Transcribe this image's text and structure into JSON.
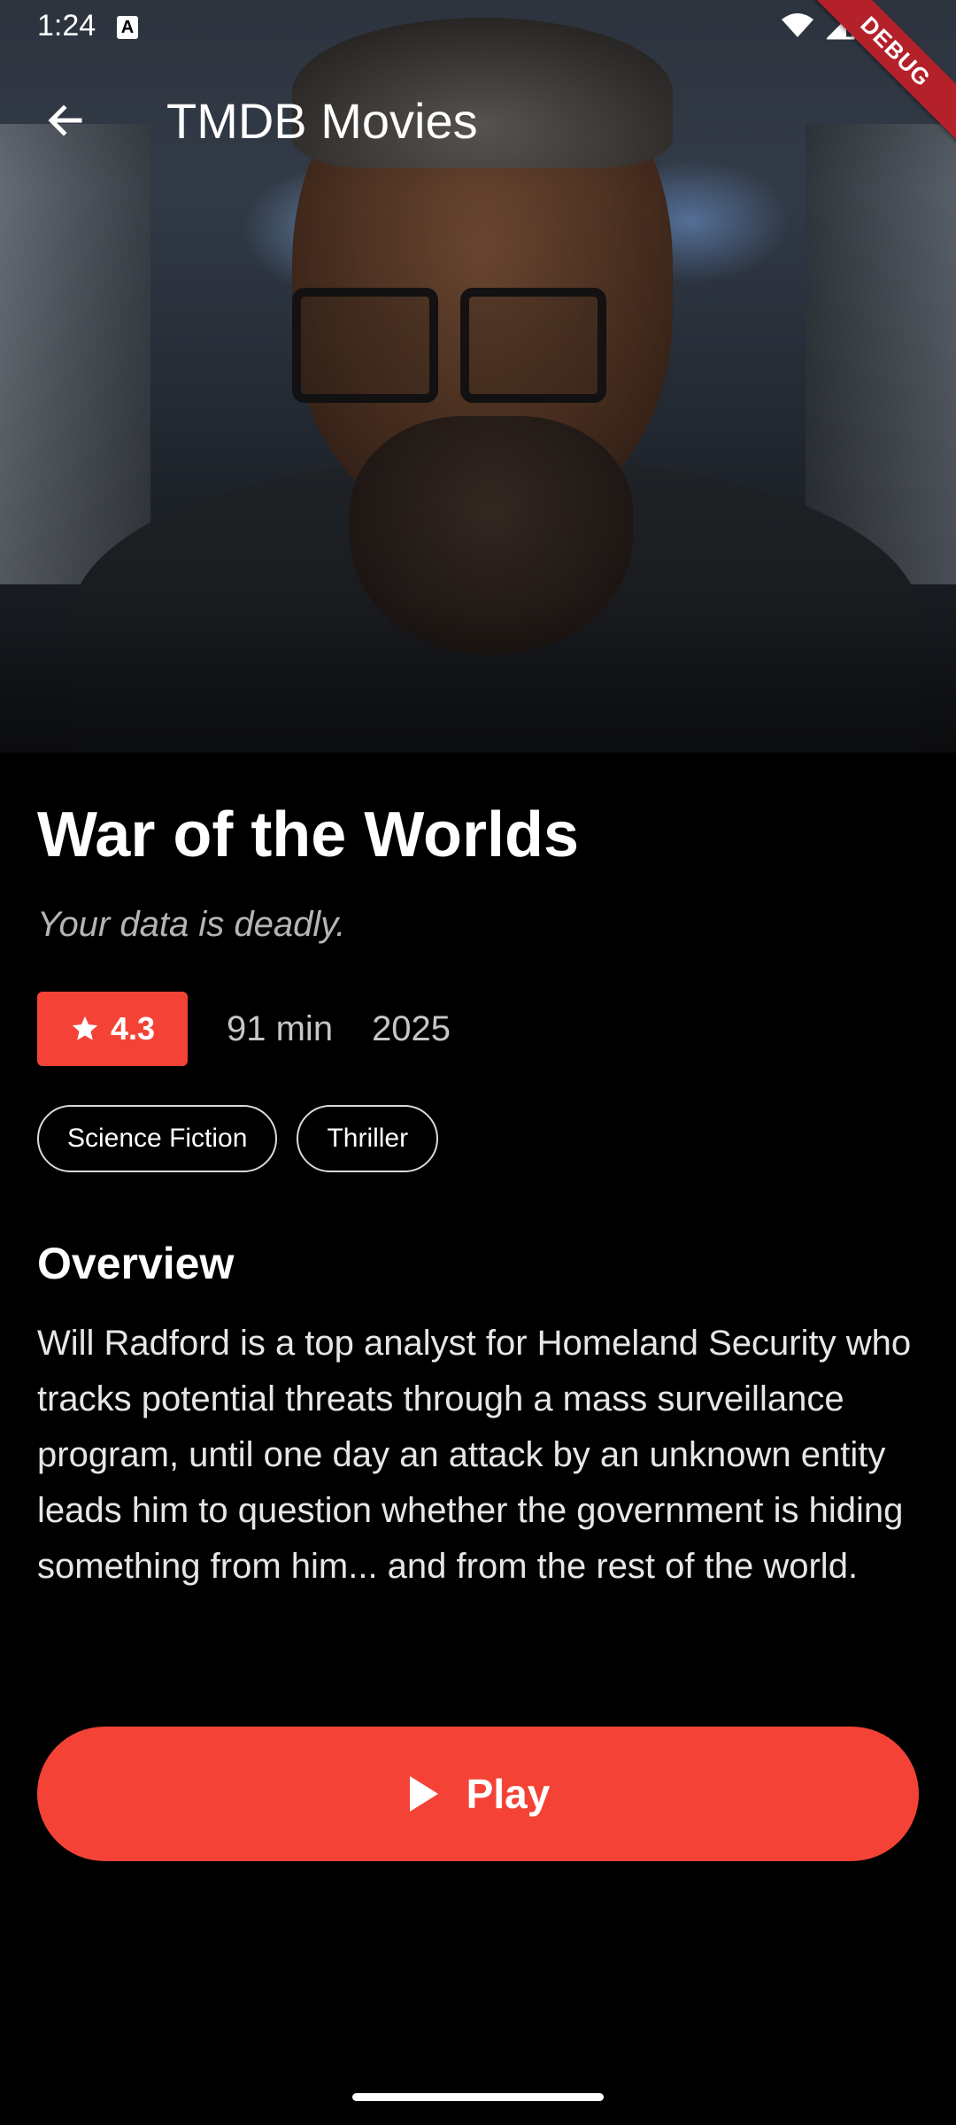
{
  "status_bar": {
    "time": "1:24",
    "icons": [
      "a-notification-icon",
      "wifi-icon",
      "signal-icon",
      "battery-icon"
    ]
  },
  "debug_banner": "DEBUG",
  "app_bar": {
    "title": "TMDB Movies",
    "back_icon": "arrow-left-icon"
  },
  "movie": {
    "title": "War of the Worlds",
    "tagline": "Your data is deadly.",
    "rating": "4.3",
    "runtime": "91 min",
    "year": "2025",
    "genres": [
      "Science Fiction",
      "Thriller"
    ],
    "overview_heading": "Overview",
    "overview": "Will Radford is a top analyst for Homeland Security who tracks potential threats through a mass surveillance program, until one day an attack by an unknown entity leads him to question whether the government is hiding something from him... and from the rest of the world."
  },
  "play_button": {
    "label": "Play",
    "icon": "play-icon"
  },
  "colors": {
    "accent": "#f44336",
    "background": "#000000",
    "debug": "#b4212b"
  }
}
